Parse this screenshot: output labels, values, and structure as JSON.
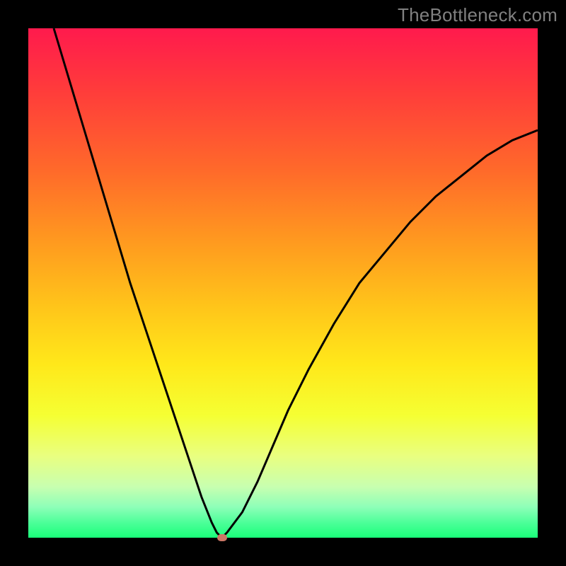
{
  "watermark": "TheBottleneck.com",
  "chart_data": {
    "type": "line",
    "title": "",
    "xlabel": "",
    "ylabel": "",
    "xlim": [
      0,
      100
    ],
    "ylim": [
      0,
      100
    ],
    "x": [
      5,
      8,
      11,
      14,
      17,
      20,
      23,
      26,
      29,
      32,
      34,
      36,
      37,
      38,
      39,
      42,
      45,
      48,
      51,
      55,
      60,
      65,
      70,
      75,
      80,
      85,
      90,
      95,
      100
    ],
    "values": [
      100,
      90,
      80,
      70,
      60,
      50,
      41,
      32,
      23,
      14,
      8,
      3,
      1,
      0,
      1,
      5,
      11,
      18,
      25,
      33,
      42,
      50,
      56,
      62,
      67,
      71,
      75,
      78,
      80
    ],
    "marker": {
      "x": 38,
      "y": 0
    },
    "gradient_stops": [
      {
        "pos": 0,
        "color": "#ff1a4d"
      },
      {
        "pos": 12,
        "color": "#ff3b3b"
      },
      {
        "pos": 28,
        "color": "#ff6a2a"
      },
      {
        "pos": 42,
        "color": "#ff9a1f"
      },
      {
        "pos": 55,
        "color": "#ffc61a"
      },
      {
        "pos": 66,
        "color": "#ffe81a"
      },
      {
        "pos": 76,
        "color": "#f5ff33"
      },
      {
        "pos": 84,
        "color": "#e9ff80"
      },
      {
        "pos": 90,
        "color": "#c8ffb0"
      },
      {
        "pos": 94,
        "color": "#8dffb8"
      },
      {
        "pos": 97,
        "color": "#4dff99"
      },
      {
        "pos": 100,
        "color": "#1aff7a"
      }
    ]
  }
}
